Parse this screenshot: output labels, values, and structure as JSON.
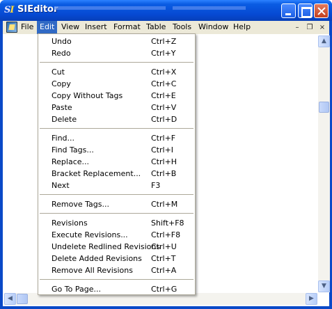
{
  "window": {
    "title": "SIEditor",
    "icon_glyphs": [
      "S",
      "I"
    ]
  },
  "menubar": {
    "items": [
      {
        "label": "File"
      },
      {
        "label": "Edit"
      },
      {
        "label": "View"
      },
      {
        "label": "Insert"
      },
      {
        "label": "Format"
      },
      {
        "label": "Table"
      },
      {
        "label": "Tools"
      },
      {
        "label": "Window"
      },
      {
        "label": "Help"
      }
    ],
    "active": "Edit"
  },
  "edit_menu": {
    "groups": [
      [
        {
          "label": "Undo",
          "shortcut": "Ctrl+Z"
        },
        {
          "label": "Redo",
          "shortcut": "Ctrl+Y"
        }
      ],
      [
        {
          "label": "Cut",
          "shortcut": "Ctrl+X"
        },
        {
          "label": "Copy",
          "shortcut": "Ctrl+C"
        },
        {
          "label": "Copy Without Tags",
          "shortcut": "Ctrl+E"
        },
        {
          "label": "Paste",
          "shortcut": "Ctrl+V"
        },
        {
          "label": "Delete",
          "shortcut": "Ctrl+D"
        }
      ],
      [
        {
          "label": "Find...",
          "shortcut": "Ctrl+F"
        },
        {
          "label": "Find Tags...",
          "shortcut": "Ctrl+I"
        },
        {
          "label": "Replace...",
          "shortcut": "Ctrl+H"
        },
        {
          "label": "Bracket Replacement...",
          "shortcut": "Ctrl+B"
        },
        {
          "label": "Next",
          "shortcut": "F3"
        }
      ],
      [
        {
          "label": "Remove Tags...",
          "shortcut": "Ctrl+M"
        }
      ],
      [
        {
          "label": "Revisions",
          "shortcut": "Shift+F8"
        },
        {
          "label": "Execute Revisions...",
          "shortcut": "Ctrl+F8"
        },
        {
          "label": "Undelete Redlined Revisions",
          "shortcut": "Ctrl+U"
        },
        {
          "label": "Delete Added Revisions",
          "shortcut": "Ctrl+T"
        },
        {
          "label": "Remove All Revisions",
          "shortcut": "Ctrl+A"
        }
      ],
      [
        {
          "label": "Go To Page...",
          "shortcut": "Ctrl+G"
        }
      ]
    ]
  },
  "colors": {
    "titlebar": "#0a5ce3",
    "menu_highlight": "#316ac5",
    "menu_background": "#ece9d8",
    "close_button": "#c4401f"
  },
  "icons": [
    "app-icon",
    "document-icon",
    "minimize-icon",
    "maximize-icon",
    "close-icon",
    "restore-icon",
    "chevron-up-icon",
    "chevron-down-icon",
    "chevron-left-icon",
    "chevron-right-icon"
  ]
}
